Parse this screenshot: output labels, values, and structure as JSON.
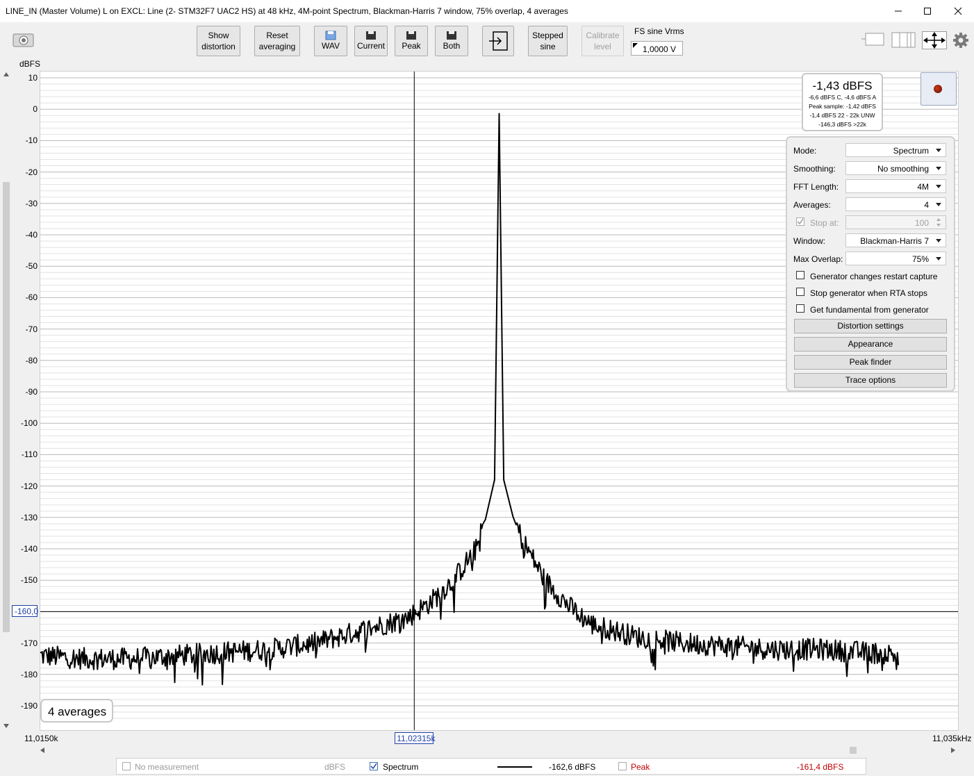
{
  "window": {
    "title": "LINE_IN (Master Volume) L on EXCL: Line (2- STM32F7 UAC2 HS) at 48 kHz, 4M-point Spectrum, Blackman-Harris 7 window, 75% overlap, 4 averages"
  },
  "toolbar": {
    "show_distortion": "Show\ndistortion",
    "reset_averaging": "Reset\naveraging",
    "wav": "WAV",
    "current": "Current",
    "peak": "Peak",
    "both": "Both",
    "stepped_sine": "Stepped\nsine",
    "calibrate_level": "Calibrate\nlevel",
    "fs_label": "FS sine Vrms",
    "fs_value": "1,0000 V"
  },
  "readout": {
    "main": "-1,43 dBFS",
    "line1": "-6,6 dBFS C, -4,6 dBFS A",
    "line2": "Peak sample: -1,42 dBFS",
    "line3": "-1,4 dBFS 22 - 22k UNW",
    "line4": "-146,3 dBFS >22k"
  },
  "settings": {
    "mode_label": "Mode:",
    "mode_value": "Spectrum",
    "smoothing_label": "Smoothing:",
    "smoothing_value": "No smoothing",
    "fft_label": "FFT Length:",
    "fft_value": "4M",
    "averages_label": "Averages:",
    "averages_value": "4",
    "stop_at_label": "Stop at:",
    "stop_at_value": "100",
    "window_label": "Window:",
    "window_value": "Blackman-Harris 7",
    "overlap_label": "Max Overlap:",
    "overlap_value": "75%",
    "gen_restart": "Generator changes restart capture",
    "stop_gen": "Stop generator when RTA stops",
    "get_fund": "Get fundamental from generator",
    "distortion_settings": "Distortion settings",
    "appearance": "Appearance",
    "peak_finder": "Peak finder",
    "trace_options": "Trace options"
  },
  "chart_data": {
    "type": "line",
    "ylabel": "dBFS",
    "ylim": [
      -195,
      10
    ],
    "yticks": [
      "10",
      "0",
      "-10",
      "-20",
      "-30",
      "-40",
      "-50",
      "-60",
      "-70",
      "-80",
      "-90",
      "-100",
      "-110",
      "-120",
      "-130",
      "-140",
      "-150",
      "-160",
      "-170",
      "-180",
      "-190"
    ],
    "xlim": [
      11.015,
      11.035
    ],
    "x_start_label": "11,0150k",
    "x_end_label": "11,035kHz",
    "cursor_x_label": "11,02315k",
    "cursor_y_label": "-160,0",
    "cursor_x": 11.02315,
    "cursor_y": -160.0,
    "grid": true,
    "series": [
      {
        "name": "Spectrum",
        "color": "#000000",
        "x": [
          11.015,
          11.016,
          11.017,
          11.018,
          11.019,
          11.02,
          11.021,
          11.022,
          11.023,
          11.0235,
          11.024,
          11.0245,
          11.0248,
          11.0249,
          11.025,
          11.0251,
          11.0252,
          11.0255,
          11.026,
          11.0265,
          11.027,
          11.028,
          11.029,
          11.03,
          11.031,
          11.032,
          11.033,
          11.034,
          11.035
        ],
        "values": [
          -174,
          -175,
          -175,
          -174,
          -173,
          -172,
          -170,
          -166,
          -162,
          -157,
          -150,
          -140,
          -126,
          -115,
          -1.4,
          -115,
          -126,
          -137,
          -150,
          -158,
          -164,
          -168,
          -170,
          -171,
          -172,
          -172,
          -173,
          -174,
          -174
        ]
      }
    ],
    "noise_amplitude": 3.5
  },
  "status": {
    "averages": "4 averages"
  },
  "legend": {
    "no_measurement": "No measurement",
    "no_measurement_unit": "dBFS",
    "spectrum": "Spectrum",
    "spectrum_value": "-162,6 dBFS",
    "peak": "Peak",
    "peak_value": "-161,4 dBFS",
    "peak_color": "#c00000"
  }
}
